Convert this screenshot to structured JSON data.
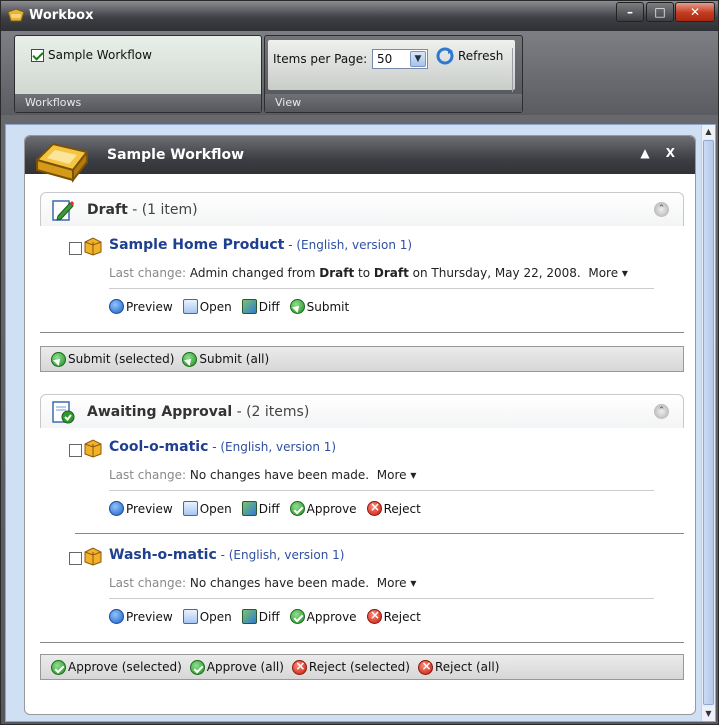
{
  "window": {
    "title": "Workbox",
    "controls": [
      "minimize",
      "maximize",
      "close"
    ]
  },
  "ribbon": {
    "workflows_group": {
      "checkbox_label": "Sample Workflow",
      "checked": true,
      "group_label": "Workflows"
    },
    "view_group": {
      "items_per_page_label": "Items per Page:",
      "items_per_page_value": "50",
      "refresh_label": "Refresh",
      "group_label": "View"
    }
  },
  "panel": {
    "title": "Sample Workflow",
    "controls": "▲ X"
  },
  "sections": [
    {
      "state": "Draft",
      "count_text": " - (1 item)",
      "items": [
        {
          "name": "Sample Home Product",
          "meta": " - (English, version 1)",
          "last_change_label": "Last change: ",
          "change_parts": [
            "Admin changed from ",
            "Draft",
            " to ",
            "Draft",
            " on Thursday, May 22, 2008."
          ],
          "more_label": "More ▾",
          "actions": [
            "Preview",
            "Open",
            "Diff",
            "Submit"
          ]
        }
      ],
      "bulk_actions": [
        "Submit (selected)",
        "Submit (all)"
      ]
    },
    {
      "state": "Awaiting Approval",
      "count_text": " - (2 items)",
      "items": [
        {
          "name": "Cool-o-matic",
          "meta": " - (English, version 1)",
          "last_change_label": "Last change: ",
          "change_text": "No changes have been made.",
          "more_label": "More ▾",
          "actions": [
            "Preview",
            "Open",
            "Diff",
            "Approve",
            "Reject"
          ]
        },
        {
          "name": "Wash-o-matic",
          "meta": " - (English, version 1)",
          "last_change_label": "Last change: ",
          "change_text": "No changes have been made.",
          "more_label": "More ▾",
          "actions": [
            "Preview",
            "Open",
            "Diff",
            "Approve",
            "Reject"
          ]
        }
      ],
      "bulk_actions": [
        "Approve (selected)",
        "Approve (all)",
        "Reject (selected)",
        "Reject (all)"
      ]
    }
  ],
  "icons": {
    "app": "workbox-icon",
    "preview": "globe-icon",
    "open": "open-document-icon",
    "diff": "diff-icon",
    "submit": "green-arrow-icon",
    "approve": "green-check-icon",
    "reject": "red-x-icon",
    "item": "package-icon"
  }
}
